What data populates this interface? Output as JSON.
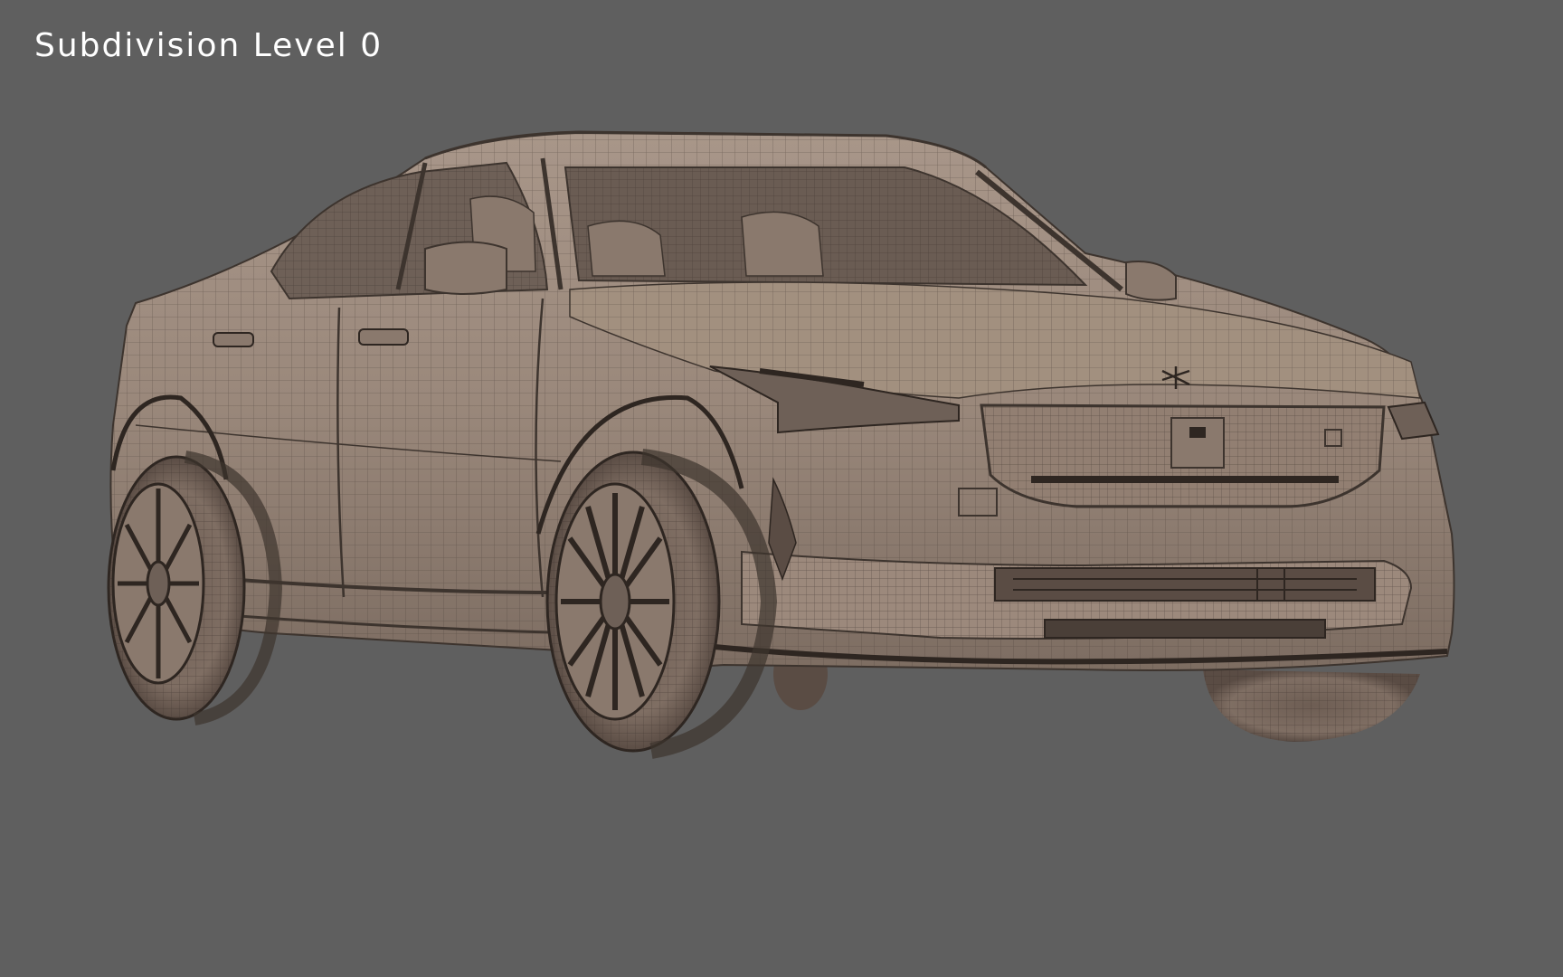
{
  "viewport": {
    "overlay_label": "Subdivision Level 0",
    "background_color": "#5f5f5f",
    "model": {
      "subject": "car wireframe mesh",
      "shading_color": "#9c8a7e",
      "wire_color": "#3d342e"
    }
  }
}
